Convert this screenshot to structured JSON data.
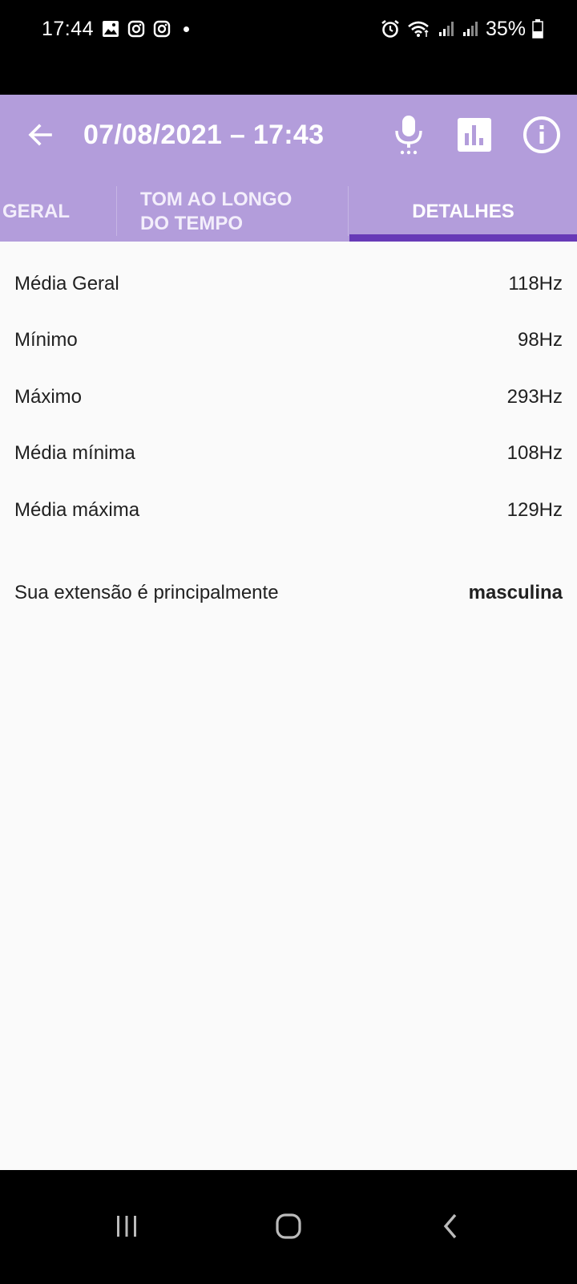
{
  "status_bar": {
    "time": "17:44",
    "battery": "35%",
    "left_icons": [
      "image-icon",
      "instagram-icon",
      "instagram-icon"
    ],
    "right_icons": [
      "alarm-icon",
      "wifi-icon",
      "signal-icon",
      "signal-icon",
      "battery-icon"
    ]
  },
  "app_bar": {
    "title": "07/08/2021 – 17:43",
    "background": "#b39ddb",
    "actions": [
      "microphone-icon",
      "bar-chart-icon",
      "info-icon"
    ]
  },
  "tabs": [
    {
      "label": "GERAL",
      "selected": false
    },
    {
      "label_line1": "TOM AO LONGO",
      "label_line2": "DO TEMPO",
      "selected": false
    },
    {
      "label": "DETALHES",
      "selected": true
    }
  ],
  "accent_color": "#673ab7",
  "details": [
    {
      "label": "Média Geral",
      "value": "118Hz"
    },
    {
      "label": "Mínimo",
      "value": "98Hz"
    },
    {
      "label": "Máximo",
      "value": "293Hz"
    },
    {
      "label": "Média mínima",
      "value": "108Hz"
    },
    {
      "label": "Média máxima",
      "value": "129Hz"
    }
  ],
  "summary": {
    "label": "Sua extensão é principalmente",
    "value": "masculina"
  },
  "nav_bar": {
    "buttons": [
      "recent-apps-icon",
      "home-icon",
      "back-icon"
    ]
  }
}
